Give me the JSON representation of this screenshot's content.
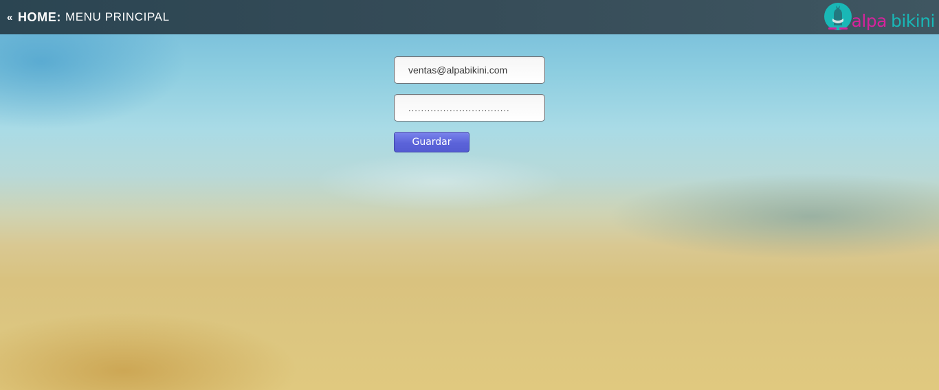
{
  "header": {
    "back_glyph": "«",
    "home_label": "HOME",
    "separator": ":",
    "menu_label": "MENU PRINCIPAL"
  },
  "logo": {
    "icon": "alpaca-logo-icon",
    "text_part1": "alpa",
    "text_part2": "bikini",
    "colors": {
      "teal": "#19b7b6",
      "pink": "#d6239c"
    }
  },
  "form": {
    "email_value": "ventas@alpabikini.com",
    "password_value": "................................",
    "save_label": "Guardar"
  },
  "colors": {
    "topbar": "#364c58",
    "button": "#5b63d9"
  }
}
